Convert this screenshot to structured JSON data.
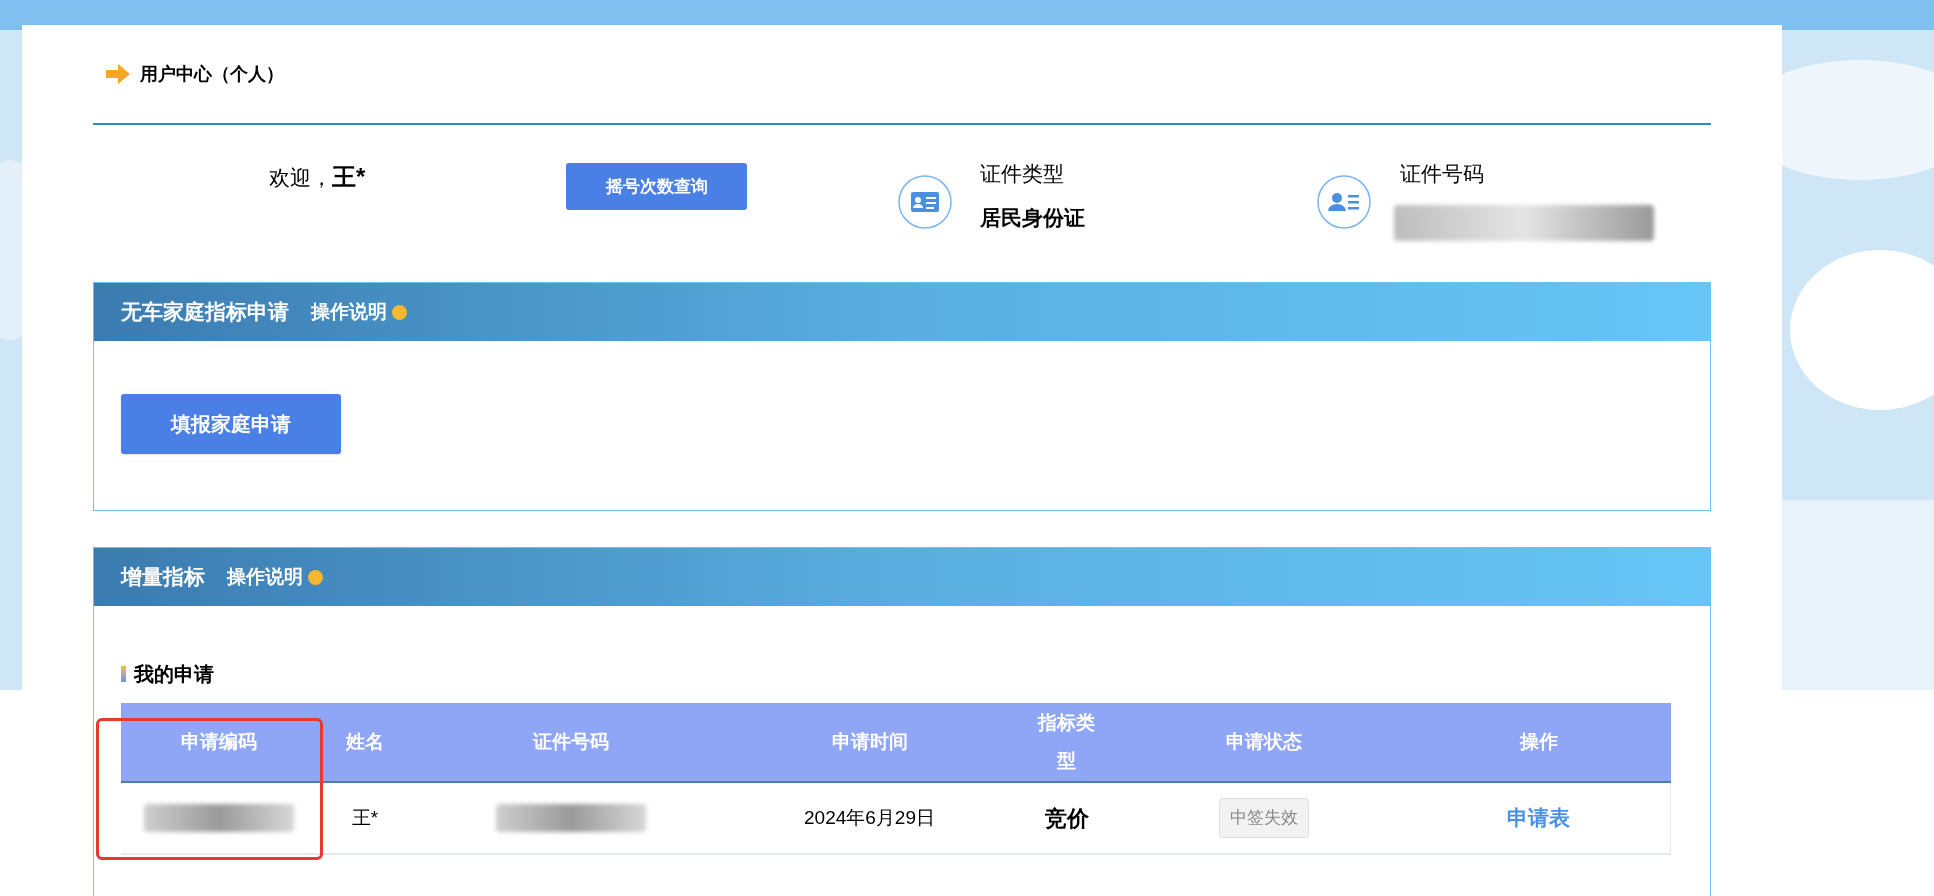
{
  "header": {
    "title": "用户中心（个人）"
  },
  "user": {
    "welcome": "欢迎，",
    "name": "王*",
    "query_button": "摇号次数查询",
    "id_type_label": "证件类型",
    "id_type": "居民身份证",
    "id_number_label": "证件号码"
  },
  "sections": [
    {
      "title": "无车家庭指标申请",
      "help": "操作说明",
      "button": "填报家庭申请"
    },
    {
      "title": "增量指标",
      "help": "操作说明",
      "subtitle": "我的申请",
      "table": {
        "columns": [
          {
            "label": "申请编码",
            "highlighted": true
          },
          {
            "label": "姓名",
            "highlighted": false
          },
          {
            "label": "证件号码",
            "highlighted": false
          },
          {
            "label": "申请时间",
            "highlighted": false
          },
          {
            "label": "指标类型",
            "highlighted": false
          },
          {
            "label": "申请状态",
            "highlighted": false
          },
          {
            "label": "操作",
            "highlighted": false
          }
        ],
        "rows": [
          {
            "cells": [
              {
                "kind": "redacted"
              },
              {
                "kind": "text",
                "text": "王*"
              },
              {
                "kind": "redacted"
              },
              {
                "kind": "text",
                "text": "2024年6月29日"
              },
              {
                "kind": "bold",
                "text": "竞价"
              },
              {
                "kind": "badge",
                "text": "中签失效"
              },
              {
                "kind": "link",
                "text": "申请表"
              }
            ]
          }
        ]
      }
    }
  ]
}
